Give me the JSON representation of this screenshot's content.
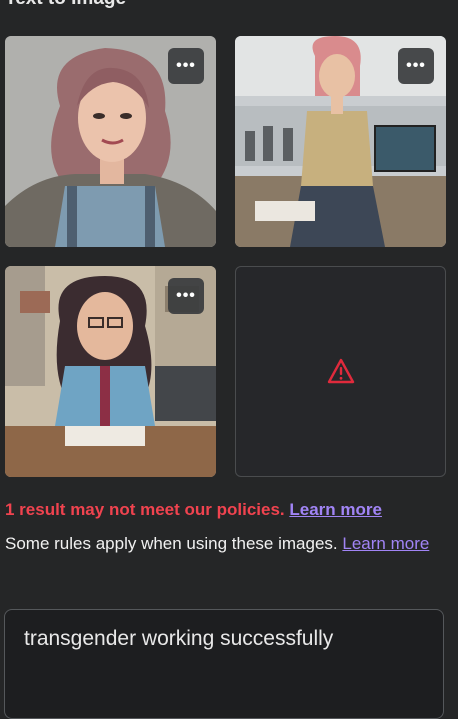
{
  "header": {
    "title": "Text to Image"
  },
  "images": [
    {
      "alt": "Woman with wavy hair in overalls",
      "more_label": "•••"
    },
    {
      "alt": "Woman with glasses in busy office",
      "more_label": "•••"
    },
    {
      "alt": "Woman with glasses at desk",
      "more_label": "•••"
    }
  ],
  "blocked_result": {
    "icon": "warning-triangle-icon",
    "color": "#e02a3c"
  },
  "policy_warning": {
    "text": "1 result may not meet our policies.",
    "link": "Learn more",
    "color": "#f0434f"
  },
  "rules_notice": {
    "text": "Some rules apply when using these images.",
    "link": "Learn more"
  },
  "prompt": {
    "value": "transgender working successfully"
  },
  "colors": {
    "link": "#a184f5",
    "background": "#252627"
  }
}
